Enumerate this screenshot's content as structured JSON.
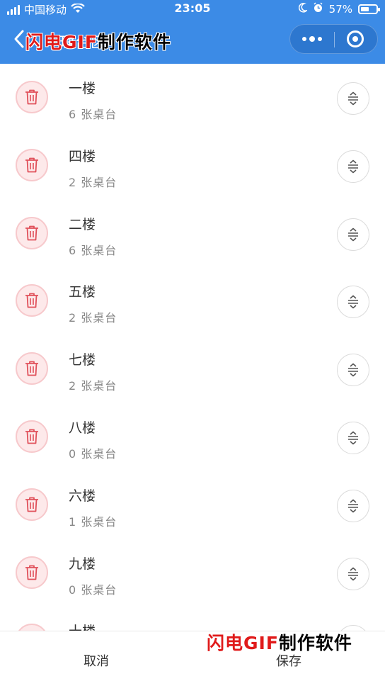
{
  "status_bar": {
    "carrier": "中国移动",
    "time": "23:05",
    "battery_percent": "57%",
    "battery_level": 0.57,
    "icons": [
      "signal-icon",
      "wifi-icon",
      "moon-icon",
      "alarm-icon",
      "battery-icon"
    ]
  },
  "nav": {
    "title": "理台区",
    "back_icon": "chevron-left-icon",
    "capsule": {
      "more_icon": "more-dots-icon",
      "close_icon": "target-icon"
    }
  },
  "watermark": {
    "brand": "闪电GIF",
    "suffix": "制作软件"
  },
  "areas": [
    {
      "name": "一楼",
      "count": "6 张桌台"
    },
    {
      "name": "四楼",
      "count": "2 张桌台"
    },
    {
      "name": "二楼",
      "count": "6 张桌台"
    },
    {
      "name": "五楼",
      "count": "2 张桌台"
    },
    {
      "name": "七楼",
      "count": "2 张桌台"
    },
    {
      "name": "八楼",
      "count": "0 张桌台"
    },
    {
      "name": "六楼",
      "count": "1 张桌台"
    },
    {
      "name": "九楼",
      "count": "0 张桌台"
    },
    {
      "name": "十楼",
      "count": ""
    }
  ],
  "row_icons": {
    "delete": "trash-icon",
    "sort": "drag-sort-icon"
  },
  "bottom_bar": {
    "cancel_label": "取消",
    "save_label": "保存"
  },
  "colors": {
    "header": "#3c8be6",
    "delete_bg": "#fde9ea",
    "delete_icon": "#e0505a"
  }
}
